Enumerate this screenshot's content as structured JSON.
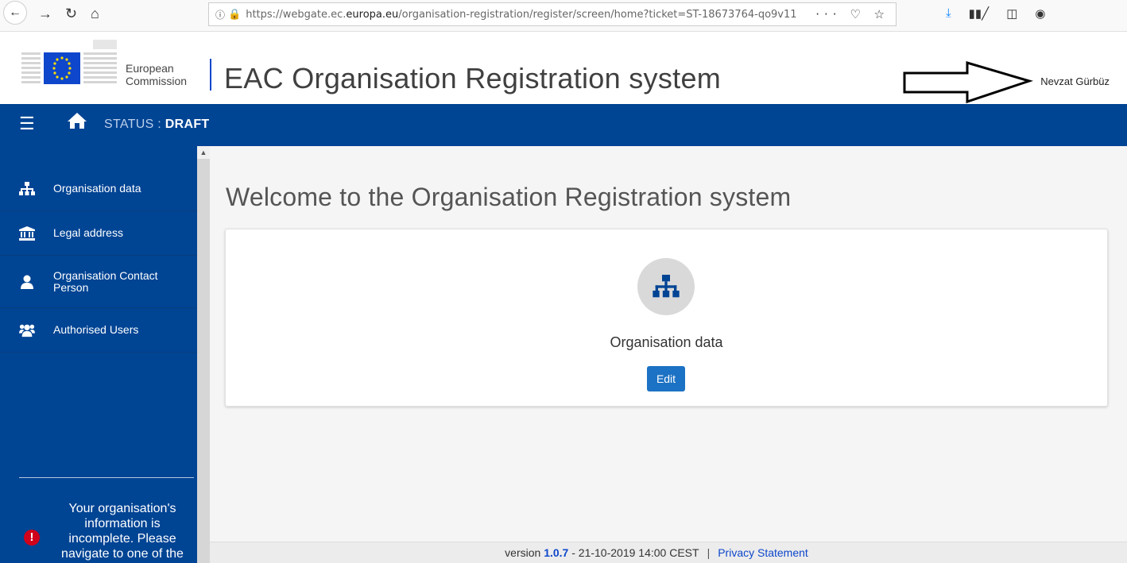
{
  "browser": {
    "url_prefix": "https://webgate.ec.",
    "url_domain": "europa.eu",
    "url_suffix": "/organisation-registration/register/screen/home?ticket=ST-18673764-qo9v11",
    "actions": "··· ♡ ☆"
  },
  "header": {
    "logo_line1": "European",
    "logo_line2": "Commission",
    "app_title": "EAC Organisation Registration system",
    "user_name": "Nevzat Gürbüz"
  },
  "topbar": {
    "status_label": "STATUS :",
    "status_value": "DRAFT"
  },
  "sidebar": {
    "items": [
      {
        "label": "Organisation data"
      },
      {
        "label": "Legal address"
      },
      {
        "label": "Organisation Contact Person"
      },
      {
        "label": "Authorised Users"
      }
    ],
    "warning": "Your organisation's information is incomplete. Please navigate to one of the"
  },
  "main": {
    "welcome": "Welcome to the Organisation Registration system",
    "card_title": "Organisation data",
    "edit_label": "Edit"
  },
  "footer": {
    "version_prefix": "version",
    "version": "1.0.7",
    "date": "- 21-10-2019 14:00 CEST",
    "separator": "|",
    "privacy": "Privacy Statement"
  },
  "colors": {
    "brand_blue": "#004494",
    "button_blue": "#1c72c4",
    "warning_red": "#d0021b"
  }
}
